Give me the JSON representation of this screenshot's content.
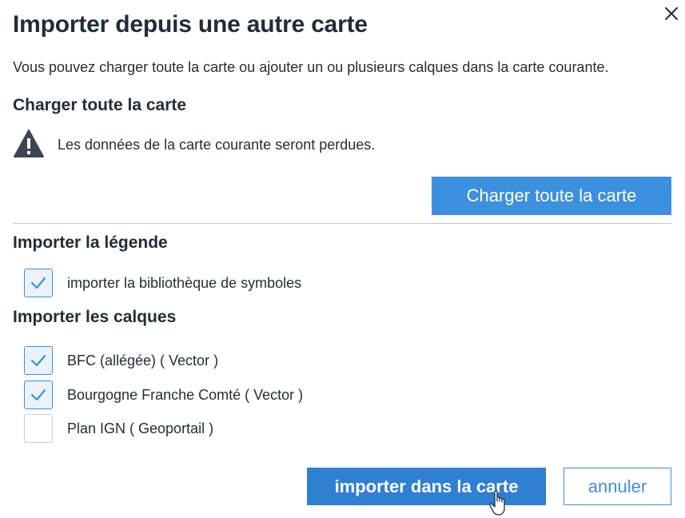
{
  "dialog": {
    "title": "Importer depuis une autre carte",
    "intro": "Vous pouvez charger toute la carte ou ajouter un ou plusieurs calques dans la carte courante.",
    "close_icon": "close-icon"
  },
  "load_section": {
    "heading": "Charger toute la carte",
    "warning_icon": "warning-icon",
    "warning_text": "Les données de la carte courante seront perdues.",
    "button_label": "Charger toute la carte"
  },
  "legend_section": {
    "heading": "Importer la légende",
    "items": [
      {
        "label": "importer la bibliothèque de symboles",
        "checked": true
      }
    ]
  },
  "layers_section": {
    "heading": "Importer les calques",
    "items": [
      {
        "label": "BFC (allégée) ( Vector )",
        "checked": true
      },
      {
        "label": "Bourgogne Franche Comté ( Vector )",
        "checked": true
      },
      {
        "label": "Plan IGN ( Geoportail )",
        "checked": false
      }
    ]
  },
  "actions": {
    "import_label": "importer dans la carte",
    "cancel_label": "annuler"
  },
  "colors": {
    "primary": "#3d8fe0",
    "text": "#1f2d3a",
    "checkbox_checked_bg": "#eaf3fc"
  }
}
